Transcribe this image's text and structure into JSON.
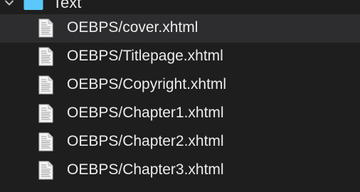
{
  "folder": {
    "name": "Text",
    "icon": "folder-icon",
    "expanded": true,
    "accent": "#5ac8fa"
  },
  "files": [
    {
      "name": "OEBPS/cover.xhtml",
      "icon": "document-icon",
      "selected": true
    },
    {
      "name": "OEBPS/Titlepage.xhtml",
      "icon": "document-icon",
      "selected": false
    },
    {
      "name": "OEBPS/Copyright.xhtml",
      "icon": "document-icon",
      "selected": false
    },
    {
      "name": "OEBPS/Chapter1.xhtml",
      "icon": "document-icon",
      "selected": false
    },
    {
      "name": "OEBPS/Chapter2.xhtml",
      "icon": "document-icon",
      "selected": false
    },
    {
      "name": "OEBPS/Chapter3.xhtml",
      "icon": "document-icon",
      "selected": false
    }
  ],
  "colors": {
    "background": "#1e1e1e",
    "selection": "#2d2d2f",
    "text": "#e8e8e8"
  }
}
